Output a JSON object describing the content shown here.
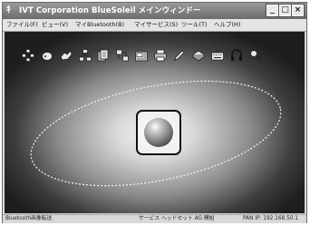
{
  "window": {
    "title_glyph": "ｷ",
    "title": "IVT Corporation BlueSoleil メインウィンドー",
    "buttons": {
      "minimize": "_",
      "maximize": "□",
      "close": "×"
    }
  },
  "menu": [
    {
      "label": "ファイル(F)"
    },
    {
      "label": "ビュー(V)"
    },
    {
      "label": "マイBluetooth(B)"
    },
    {
      "label": "マイサービス(S)"
    },
    {
      "label": "ツール(T)"
    },
    {
      "label": "ヘルプ(H)"
    }
  ],
  "toolbar_icons": [
    "network-icon",
    "mouse-icon",
    "hand-icon",
    "lan-icon",
    "file-transfer-icon",
    "sync-icon",
    "fax-icon",
    "printer-icon",
    "pen-icon",
    "modem-icon",
    "keyboard-icon",
    "headset-icon",
    "key-icon"
  ],
  "status": {
    "left": "Bluetooth画像転送",
    "middle": "サービス ヘッドセット AG 開始",
    "right": "PAN IP: 192.168.50.1"
  }
}
